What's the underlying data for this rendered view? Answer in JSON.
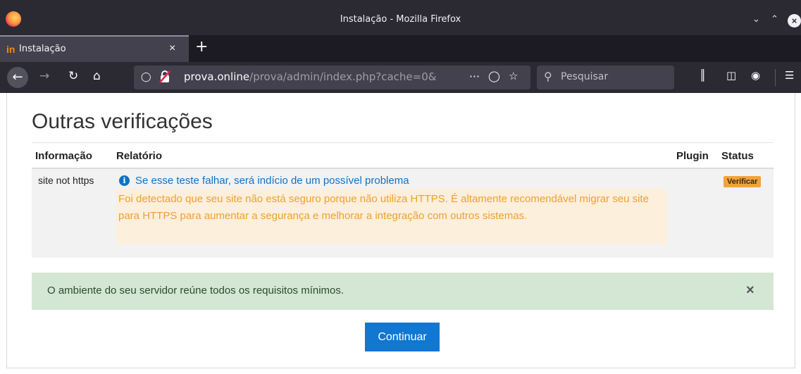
{
  "window": {
    "title": "Instalação - Mozilla Firefox"
  },
  "tabs": [
    {
      "label": "Instalação",
      "favicon": "in"
    }
  ],
  "navbar": {
    "url_host": "prova.online",
    "url_path": "/prova/admin/index.php?cache=0&",
    "search_placeholder": "Pesquisar"
  },
  "page": {
    "section_title": "Outras verificações",
    "table": {
      "headers": [
        "Informação",
        "Relatório",
        "Plugin",
        "Status"
      ],
      "rows": [
        {
          "info": "site not https",
          "report_title": "Se esse teste falhar, será indício de um possível problema",
          "report_detail": "Foi detectado que seu site não está seguro porque não utiliza HTTPS. É altamente recomendável migrar seu site para HTTPS para aumentar a segurança e melhorar a integração com outros sistemas.",
          "plugin": "",
          "status": "Verificar"
        }
      ]
    },
    "alert": {
      "message": "O ambiente do seu servidor reúne todos os requisitos mínimos."
    },
    "continue_button": "Continuar"
  },
  "colors": {
    "link": "#1171c4",
    "warning_text": "#f0a030",
    "warning_bg": "#fcefdc",
    "badge": "#f0a33a",
    "success_bg": "#d4e7d4",
    "primary_button": "#1177d1"
  }
}
